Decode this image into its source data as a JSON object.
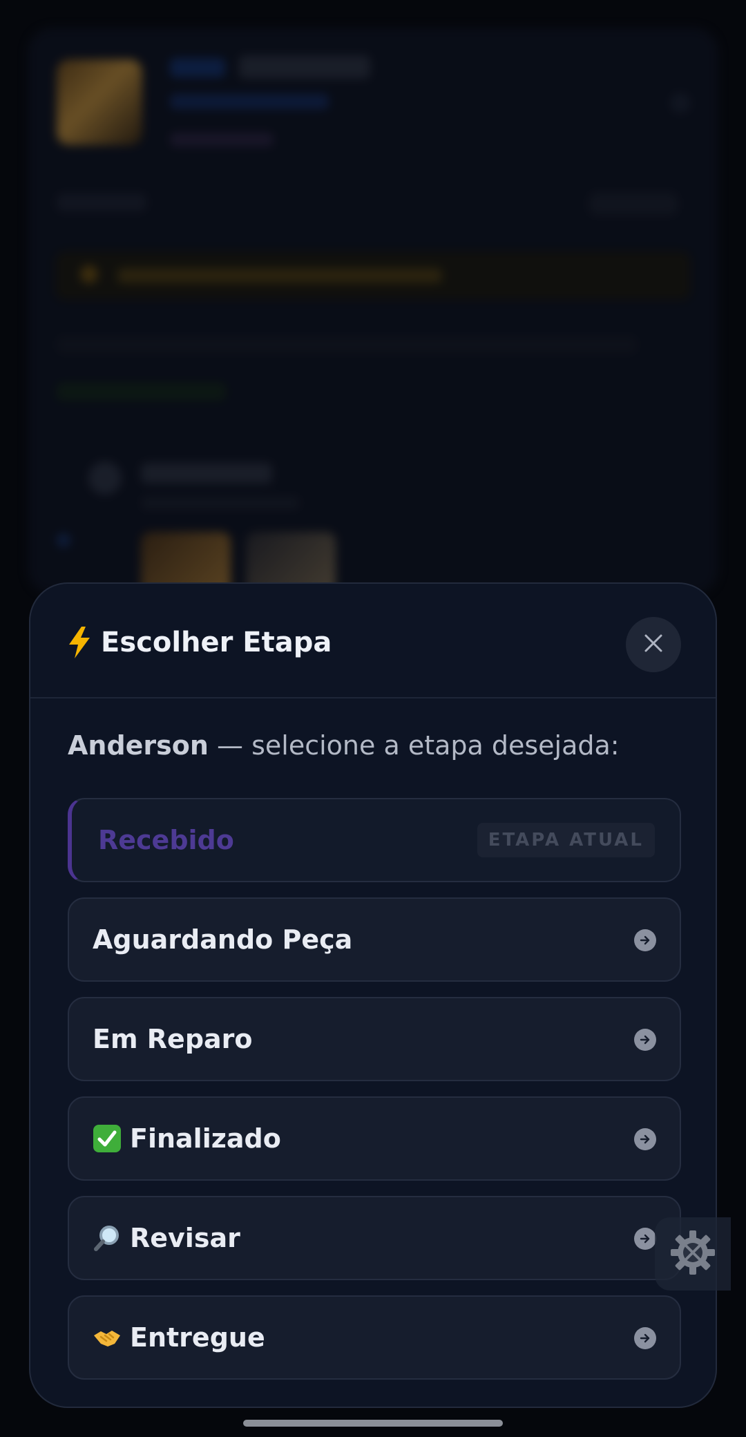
{
  "sheet": {
    "title": "Escolher Etapa",
    "client_name": "Anderson",
    "instruction": " — selecione a etapa desejada:"
  },
  "stages": [
    {
      "label": "Recebido",
      "current": true,
      "badge": "ETAPA ATUAL"
    },
    {
      "label": "Aguardando Peça",
      "icon": ""
    },
    {
      "label": "Em Reparo",
      "icon": ""
    },
    {
      "label": "Finalizado",
      "icon": "check-emoji-icon"
    },
    {
      "label": "Revisar",
      "icon": "magnifier-emoji-icon"
    },
    {
      "label": "Entregue",
      "icon": "handshake-emoji-icon"
    }
  ],
  "colors": {
    "sheet_bg": "#0d1424",
    "stage_bg": "#161d2d",
    "current_stage_text": "#4d3a94",
    "accent_bolt": "#f5b400"
  }
}
